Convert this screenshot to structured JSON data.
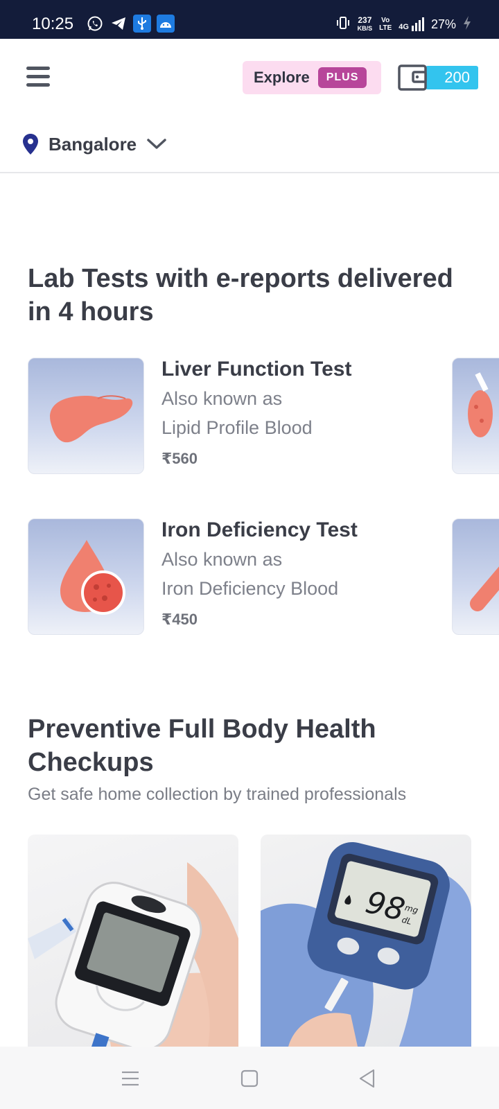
{
  "status_bar": {
    "time": "10:25",
    "net_speed_value": "237",
    "net_speed_unit": "KB/S",
    "volte_top": "Vo",
    "volte_bottom": "LTE",
    "network": "4G",
    "battery": "27%",
    "icons": [
      "whatsapp-icon",
      "telegram-icon",
      "usb-icon",
      "android-icon",
      "vibrate-icon",
      "signal-icon",
      "battery-charging-icon"
    ]
  },
  "header": {
    "explore_label": "Explore",
    "plus_badge": "PLUS",
    "wallet_count": "200"
  },
  "location": {
    "city": "Bangalore"
  },
  "lab_tests": {
    "title": "Lab Tests with e-reports delivered in 4 hours",
    "items": [
      {
        "name": "Liver Function Test",
        "aka_label": "Also known as",
        "alias": "Lipid Profile Blood",
        "price": "₹560",
        "icon": "liver-icon"
      },
      {
        "name": "Iron Deficiency Test",
        "aka_label": "Also known as",
        "alias": "Iron Deficiency Blood",
        "price": "₹450",
        "icon": "blood-drop-icon"
      }
    ]
  },
  "checkups": {
    "title": "Preventive Full Body Health Checkups",
    "subtitle": "Get safe home collection by trained professionals",
    "meter2_reading": "98",
    "meter2_unit_top": "mg",
    "meter2_unit_bottom": "dL"
  },
  "colors": {
    "status_bar": "#131c3a",
    "plus_badge": "#b7469a",
    "explore_chip": "#fcdcf0",
    "wallet": "#33c4ee",
    "location_pin": "#27318f",
    "organ": "#f0806f"
  }
}
